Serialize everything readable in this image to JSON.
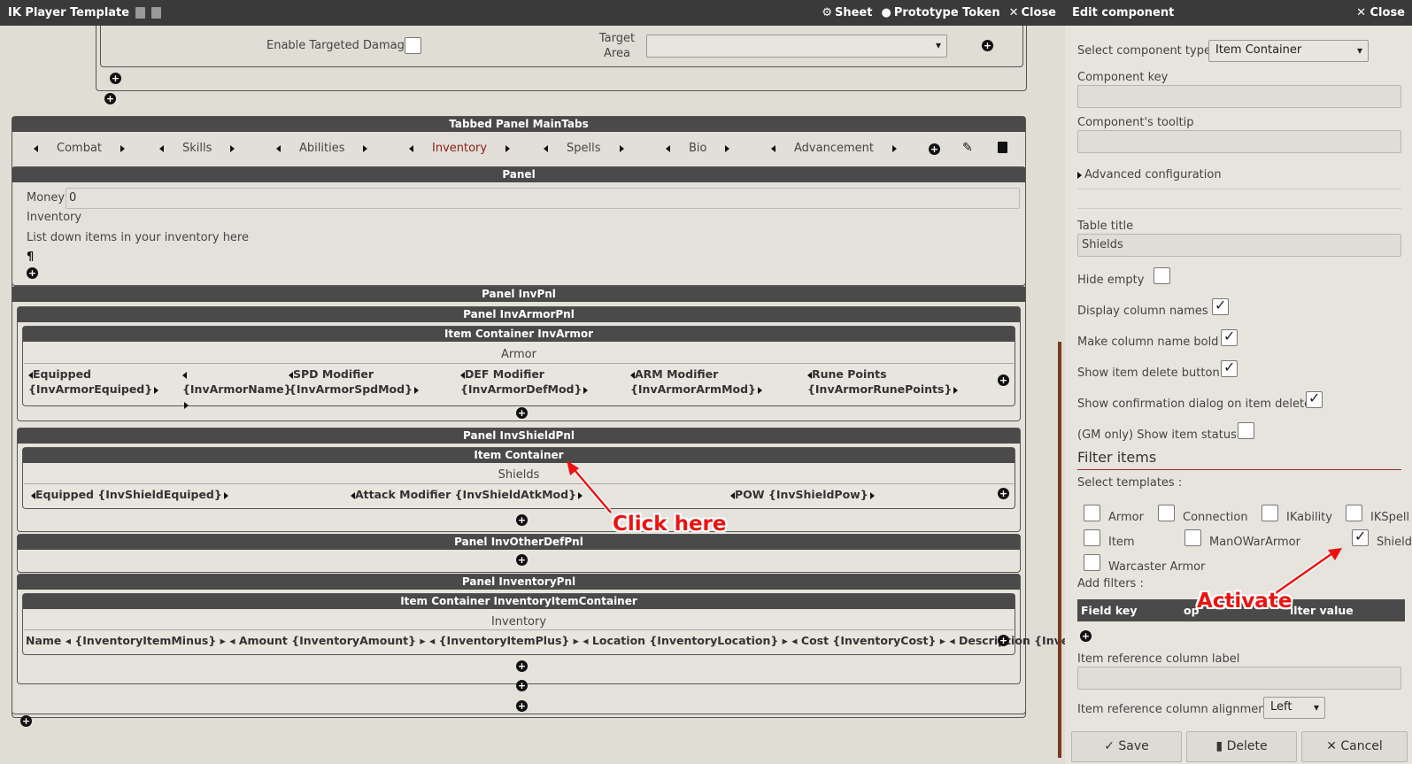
{
  "window": {
    "title": "IK Player Template",
    "sheet_label": "Sheet",
    "token_label": "Prototype Token",
    "close_label": "Close"
  },
  "top_section": {
    "enable_targeted_damage_label": "Enable Targeted Damage",
    "target_area_label": "Target Area"
  },
  "tabbed_panel": {
    "title": "Tabbed Panel MainTabs",
    "tabs": [
      "Combat",
      "Skills",
      "Abilities",
      "Inventory",
      "Spells",
      "Bio",
      "Advancement"
    ],
    "active_tab": "Inventory"
  },
  "panel": {
    "title": "Panel",
    "money_label": "Money",
    "money_value": "0",
    "inventory_label": "Inventory",
    "inventory_text": "List down items in your inventory here",
    "pilcrow": "¶"
  },
  "inv_panel": {
    "title": "Panel InvPnl",
    "armor_panel_title": "Panel InvArmorPnl",
    "armor_container_title": "Item Container InvArmor",
    "armor_table_title": "Armor",
    "armor_cols": [
      "Equipped {InvArmorEquiped}",
      "{InvArmorName}",
      "SPD Modifier {InvArmorSpdMod}",
      "DEF Modifier {InvArmorDefMod}",
      "ARM Modifier {InvArmorArmMod}",
      "Rune Points {InvArmorRunePoints}"
    ],
    "shield_panel_title": "Panel InvShieldPnl",
    "shield_container_title": "Item Container",
    "shield_table_title": "Shields",
    "shield_cols": [
      "Equipped {InvShieldEquiped}",
      "Attack Modifier {InvShieldAtkMod}",
      "POW {InvShieldPow}"
    ],
    "other_panel_title": "Panel InvOtherDefPnl",
    "inventory_panel_title": "Panel InventoryPnl",
    "inventory_container_title": "Item Container InventoryItemContainer",
    "inventory_table_title": "Inventory",
    "inventory_cols": "Name ◂ {InventoryItemMinus} ▸ ◂ Amount {InventoryAmount} ▸ ◂ {InventoryItemPlus} ▸ ◂ Location {InventoryLocation} ▸ ◂ Cost {InventoryCost} ▸ ◂ Description {InventoryDescription} ▸"
  },
  "annotations": {
    "click_here": "Click here",
    "activate": "Activate"
  },
  "editor": {
    "title": "Edit component",
    "close_label": "Close",
    "component_type_label": "Select component type",
    "component_type_value": "Item Container",
    "component_key_label": "Component key",
    "component_key_value": "",
    "tooltip_label": "Component's tooltip",
    "tooltip_value": "",
    "advanced_label": "Advanced configuration",
    "table_title_label": "Table title",
    "table_title_value": "Shields",
    "hide_empty_label": "Hide empty",
    "display_column_names_label": "Display column names",
    "make_bold_label": "Make column name bold",
    "show_delete_label": "Show item delete button",
    "show_confirm_label": "Show confirmation dialog on item delete",
    "gm_status_label": "(GM only) Show item status",
    "filter_heading": "Filter items",
    "select_templates_label": "Select templates :",
    "templates": [
      "Armor",
      "Connection",
      "IKability",
      "IKSpell",
      "Item",
      "ManOWarArmor",
      "Shield",
      "Warcaster Armor"
    ],
    "add_filters_label": "Add filters :",
    "filter_cols": [
      "Field key",
      "operator",
      "Filter value"
    ],
    "filter_col_op_visible": "op",
    "filter_col_value_visible": "ilter value",
    "ref_col_label": "Item reference column label",
    "ref_align_label": "Item reference column alignment",
    "ref_align_value": "Left",
    "save_label": "Save",
    "delete_label": "Delete",
    "cancel_label": "Cancel"
  }
}
